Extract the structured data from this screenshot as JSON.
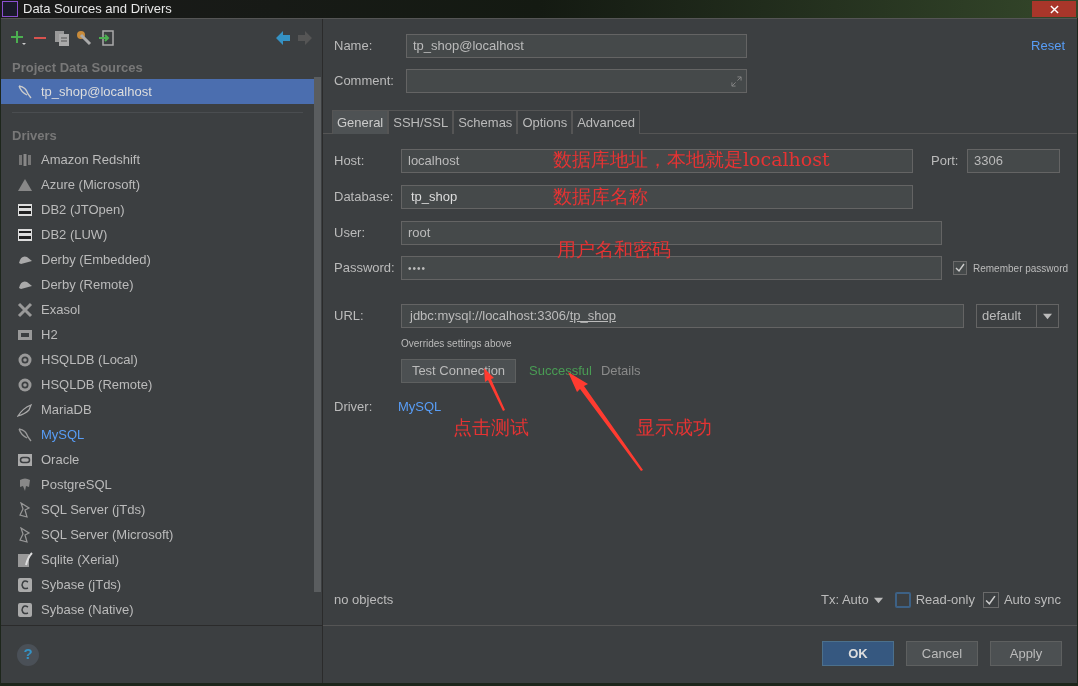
{
  "window": {
    "title": "Data Sources and Drivers"
  },
  "sidebar": {
    "sections": [
      {
        "title": "Project Data Sources",
        "items": [
          {
            "label": "tp_shop@localhost",
            "selected": true
          }
        ]
      },
      {
        "title": "Drivers",
        "items": [
          {
            "label": "Amazon Redshift",
            "selected": false,
            "highlighted": false
          },
          {
            "label": "Azure (Microsoft)",
            "selected": false,
            "highlighted": false
          },
          {
            "label": "DB2 (JTOpen)",
            "selected": false,
            "highlighted": false
          },
          {
            "label": "DB2 (LUW)",
            "selected": false,
            "highlighted": false
          },
          {
            "label": "Derby (Embedded)",
            "selected": false,
            "highlighted": false
          },
          {
            "label": "Derby (Remote)",
            "selected": false,
            "highlighted": false
          },
          {
            "label": "Exasol",
            "selected": false,
            "highlighted": false
          },
          {
            "label": "H2",
            "selected": false,
            "highlighted": false
          },
          {
            "label": "HSQLDB (Local)",
            "selected": false,
            "highlighted": false
          },
          {
            "label": "HSQLDB (Remote)",
            "selected": false,
            "highlighted": false
          },
          {
            "label": "MariaDB",
            "selected": false,
            "highlighted": false
          },
          {
            "label": "MySQL",
            "selected": false,
            "highlighted": true
          },
          {
            "label": "Oracle",
            "selected": false,
            "highlighted": false
          },
          {
            "label": "PostgreSQL",
            "selected": false,
            "highlighted": false
          },
          {
            "label": "SQL Server (jTds)",
            "selected": false,
            "highlighted": false
          },
          {
            "label": "SQL Server (Microsoft)",
            "selected": false,
            "highlighted": false
          },
          {
            "label": "Sqlite (Xerial)",
            "selected": false,
            "highlighted": false
          },
          {
            "label": "Sybase (jTds)",
            "selected": false,
            "highlighted": false
          },
          {
            "label": "Sybase (Native)",
            "selected": false,
            "highlighted": false
          }
        ]
      }
    ]
  },
  "form": {
    "name_label": "Name:",
    "name": "tp_shop@localhost",
    "reset": "Reset",
    "comment_label": "Comment:",
    "tabs": [
      {
        "label": "General",
        "selected": true
      },
      {
        "label": "SSH/SSL",
        "selected": false
      },
      {
        "label": "Schemas",
        "selected": false
      },
      {
        "label": "Options",
        "selected": false
      },
      {
        "label": "Advanced",
        "selected": false
      }
    ],
    "host_label": "Host:",
    "host": "localhost",
    "port_label": "Port:",
    "port": "3306",
    "database_label": "Database:",
    "database": "tp_shop",
    "user_label": "User:",
    "user": "root",
    "password_label": "Password:",
    "password": "••••",
    "remember_password": {
      "label": "Remember password",
      "checked": true
    },
    "url_label": "URL:",
    "url_prefix": "jdbc:mysql://localhost:3306/",
    "url_database": "tp_shop",
    "url_mode": "default",
    "url_hint": "Overrides settings above",
    "test_button": "Test Connection",
    "test_result": "Successful",
    "details": "Details",
    "driver_label": "Driver:",
    "driver": "MySQL",
    "objects": "no objects",
    "tx": "Tx: Auto",
    "read_only": {
      "label": "Read-only",
      "checked": false
    },
    "auto_sync": {
      "label": "Auto sync",
      "checked": true
    }
  },
  "help": "?",
  "buttons": [
    {
      "label": "OK",
      "default": true
    },
    {
      "label": "Cancel",
      "default": false
    },
    {
      "label": "Apply",
      "default": false
    }
  ],
  "annotations": [
    "数据库地址，本地就是localhost",
    "数据库名称",
    "用户名和密码",
    "点击测试",
    "显示成功"
  ]
}
